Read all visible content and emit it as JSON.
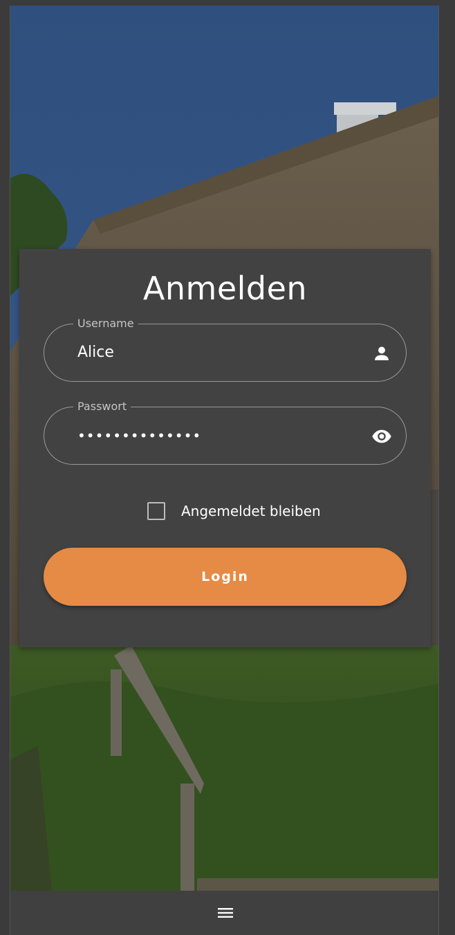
{
  "card": {
    "title": "Anmelden"
  },
  "username": {
    "label": "Username",
    "value": "Alice",
    "icon": "person-icon"
  },
  "password": {
    "label": "Passwort",
    "value": "••••••••••••••",
    "icon": "eye-icon"
  },
  "remember": {
    "label": "Angemeldet bleiben",
    "checked": false
  },
  "login_button": {
    "label": "Login"
  },
  "bottom_bar": {
    "icon": "hamburger-menu-icon"
  },
  "colors": {
    "accent": "#e58b45",
    "card": "#424242",
    "bar": "#404040"
  }
}
